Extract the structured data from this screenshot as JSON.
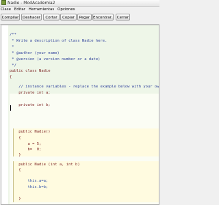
{
  "window": {
    "title": "Nadie - ModAcademia2"
  },
  "menubar": {
    "items": [
      "Clase",
      "Editar",
      "Herramientas",
      "Opciones"
    ]
  },
  "toolbar": {
    "compile": "Compilar",
    "undo": "Deshacer",
    "cut": "Cortar",
    "copy": "Copiar",
    "paste": "Pegar",
    "find": "Encontrar...",
    "close": "Cerrar"
  },
  "editor": {
    "lines": [
      "/**",
      " * Write a description of class Nadie here.",
      " *",
      " * @author (your name)",
      " * @version (a version number or a date)",
      " */",
      "public class Nadie",
      "{",
      "    // instance variables - replace the example below with your own",
      "    private int a;",
      "",
      "    private int b;",
      "",
      "    public Nadie()",
      "    {",
      "        a = 5;",
      "        b=  0;",
      "    }",
      "",
      "    public Nadie (int a, int b)",
      "    {",
      "",
      "        this.a=a;",
      "        this.b=b;",
      "",
      "    }",
      "",
      "}"
    ]
  }
}
